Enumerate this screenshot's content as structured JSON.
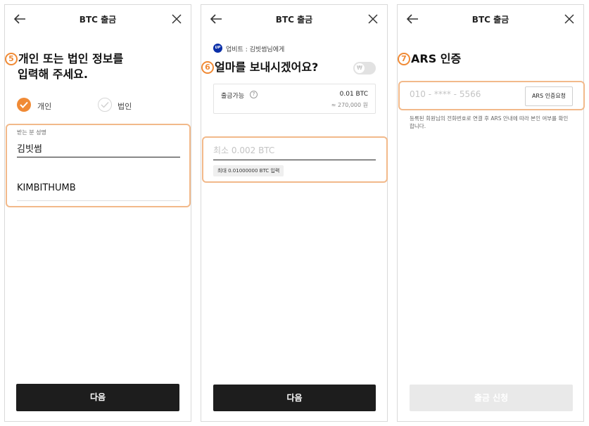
{
  "screens": [
    {
      "title": "BTC 출금",
      "step": "5",
      "heading_line1": "개인 또는 법인 정보를",
      "heading_line2": "입력해 주세요.",
      "option_personal": "개인",
      "option_corporate": "법인",
      "name_label": "받는 분 성명",
      "name_value": "김빗썸",
      "english_name_value": "KIMBITHUMB",
      "next_button": "다음"
    },
    {
      "title": "BTC 출금",
      "exchange_logo_text": "UP",
      "recipient": "업비트 : 김빗썸님에게",
      "step": "6",
      "heading": "얼마를 보내시겠어요?",
      "currency_toggle_icon": "₩",
      "available_label": "출금가능",
      "help_icon": "?",
      "available_btc": "0.01 BTC",
      "available_krw": "≈ 270,000 원",
      "amount_placeholder": "최소 0.002 BTC",
      "max_chip": "최대 0.01000000 BTC 입력",
      "next_button": "다음"
    },
    {
      "title": "BTC 출금",
      "step": "7",
      "heading": "ARS 인증",
      "phone_placeholder": "010 - **** - 5566",
      "ars_button": "ARS 인증요청",
      "notice": "등록된 회원님의 전화번호로 연결 후 ARS 안내에 따라 본인 여부를 확인합니다.",
      "submit_button": "출금 신청"
    }
  ],
  "colors": {
    "accent": "#f08a35",
    "highlight": "#f2b98a",
    "button_dark": "#1d1d1d",
    "button_disabled": "#e9e9e9",
    "upbit_blue": "#0a2fa8"
  }
}
